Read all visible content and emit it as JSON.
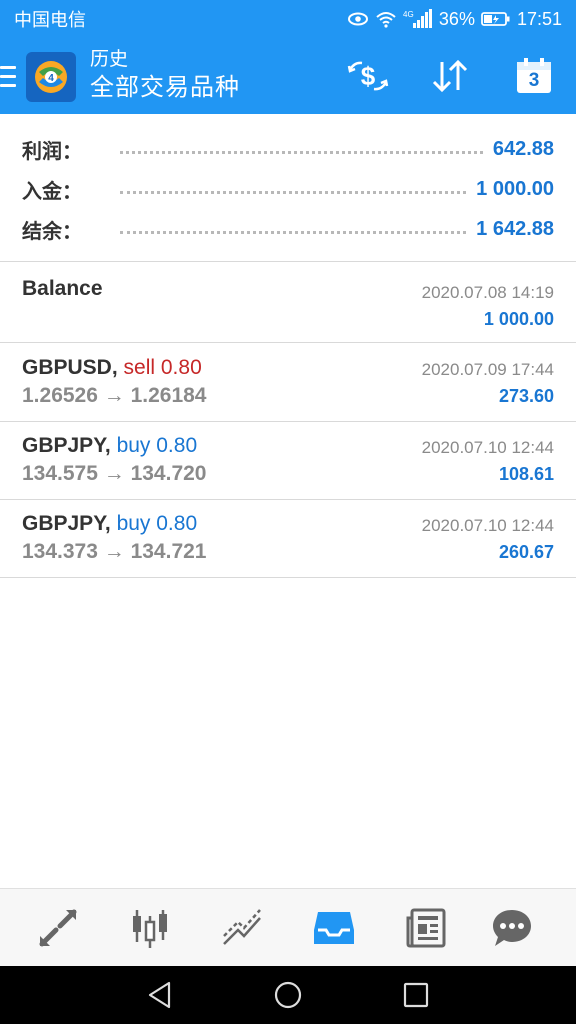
{
  "status_bar": {
    "carrier": "中国电信",
    "battery": "36%",
    "time": "17:51",
    "network": "4G"
  },
  "app_bar": {
    "title": "历史",
    "subtitle": "全部交易品种",
    "calendar_day": "3"
  },
  "summary": [
    {
      "label": "利润：",
      "value": "642.88"
    },
    {
      "label": "入金：",
      "value": "1 000.00"
    },
    {
      "label": "结余：",
      "value": "1 642.88"
    }
  ],
  "balance_entry": {
    "label": "Balance",
    "time": "2020.07.08 14:19",
    "amount": "1 000.00"
  },
  "deals": [
    {
      "symbol": "GBPUSD,",
      "side": "sell 0.80",
      "prices": "1.26526 → 1.26184",
      "time": "2020.07.09 17:44",
      "profit": "273.60"
    },
    {
      "symbol": "GBPJPY,",
      "side": "buy 0.80",
      "prices": "134.575 → 134.720",
      "time": "2020.07.10 12:44",
      "profit": "108.61"
    },
    {
      "symbol": "GBPJPY,",
      "side": "buy 0.80",
      "prices": "134.373 → 134.721",
      "time": "2020.07.10 12:44",
      "profit": "260.67"
    }
  ],
  "colors": {
    "primary": "#2196f3",
    "profit_blue": "#1976d2",
    "sell_red": "#c62828",
    "muted_gray": "#8a8a8a"
  },
  "bottom_nav": [
    {
      "icon": "trade-arrows-icon"
    },
    {
      "icon": "candlestick-chart-icon"
    },
    {
      "icon": "trend-lines-icon"
    },
    {
      "icon": "history-tray-icon",
      "active": true
    },
    {
      "icon": "news-icon"
    },
    {
      "icon": "chat-icon"
    }
  ]
}
